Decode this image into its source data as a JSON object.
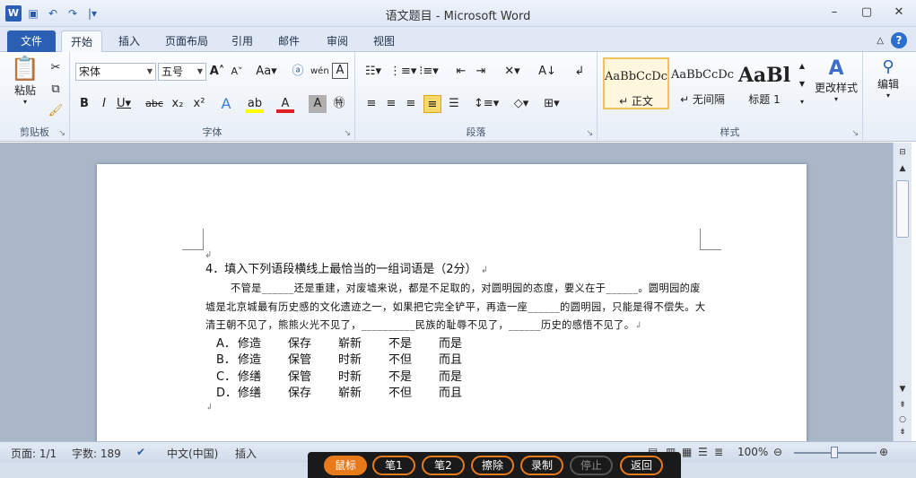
{
  "window": {
    "title": "语文题目 - Microsoft Word",
    "app_letter": "W",
    "controls": [
      "–",
      "▢",
      "✕"
    ]
  },
  "qat": {
    "save": "💾",
    "undo": "↶",
    "redo": "↷",
    "customize": "|▾"
  },
  "tabs": [
    {
      "label": "文件"
    },
    {
      "label": "开始"
    },
    {
      "label": "插入"
    },
    {
      "label": "页面布局"
    },
    {
      "label": "引用"
    },
    {
      "label": "邮件"
    },
    {
      "label": "审阅"
    },
    {
      "label": "视图"
    }
  ],
  "ribbon": {
    "clipboard": {
      "label": "剪贴板",
      "paste": "粘贴"
    },
    "font": {
      "label": "字体",
      "font_name": "宋体",
      "font_size": "五号"
    },
    "paragraph": {
      "label": "段落"
    },
    "styles": {
      "label": "样式",
      "items": [
        {
          "sample": "AaBbCcDc",
          "name": "↵ 正文"
        },
        {
          "sample": "AaBbCcDc",
          "name": "↵ 无间隔"
        },
        {
          "sample": "AaBl",
          "name": "标题 1"
        }
      ],
      "change": "更改样式"
    },
    "editing": {
      "label": "编辑"
    }
  },
  "document": {
    "question": "4．填入下列语段横线上最恰当的一组词语是（2分）",
    "paragraph": "不管是______还是重建，对废墟来说，都是不足取的，对圆明园的态度，要义在于______。圆明园的废墟是北京城最有历史感的文化遗迹之一，如果把它完全铲平，再造一座______的圆明园，只能是得不偿失。大清王朝不见了，熊熊火光不见了，__________民族的耻辱不见了，______历史的感悟不见了。",
    "options": [
      {
        "letter": "A．",
        "words": [
          "修造",
          "保存",
          "崭新",
          "不是",
          "而是"
        ]
      },
      {
        "letter": "B．",
        "words": [
          "修造",
          "保管",
          "时新",
          "不但",
          "而且"
        ]
      },
      {
        "letter": "C．",
        "words": [
          "修缮",
          "保管",
          "时新",
          "不是",
          "而是"
        ]
      },
      {
        "letter": "D．",
        "words": [
          "修缮",
          "保存",
          "崭新",
          "不但",
          "而且"
        ]
      }
    ]
  },
  "status": {
    "page": "页面: 1/1",
    "words": "字数: 189",
    "language": "中文(中国)",
    "mode": "插入",
    "zoom": "100%",
    "zoom_level": 1.0
  },
  "overlay_toolbar": [
    {
      "label": "鼠标",
      "state": "active"
    },
    {
      "label": "笔1",
      "state": "normal"
    },
    {
      "label": "笔2",
      "state": "normal"
    },
    {
      "label": "擦除",
      "state": "normal"
    },
    {
      "label": "录制",
      "state": "normal"
    },
    {
      "label": "停止",
      "state": "disabled"
    },
    {
      "label": "返回",
      "state": "normal"
    }
  ]
}
